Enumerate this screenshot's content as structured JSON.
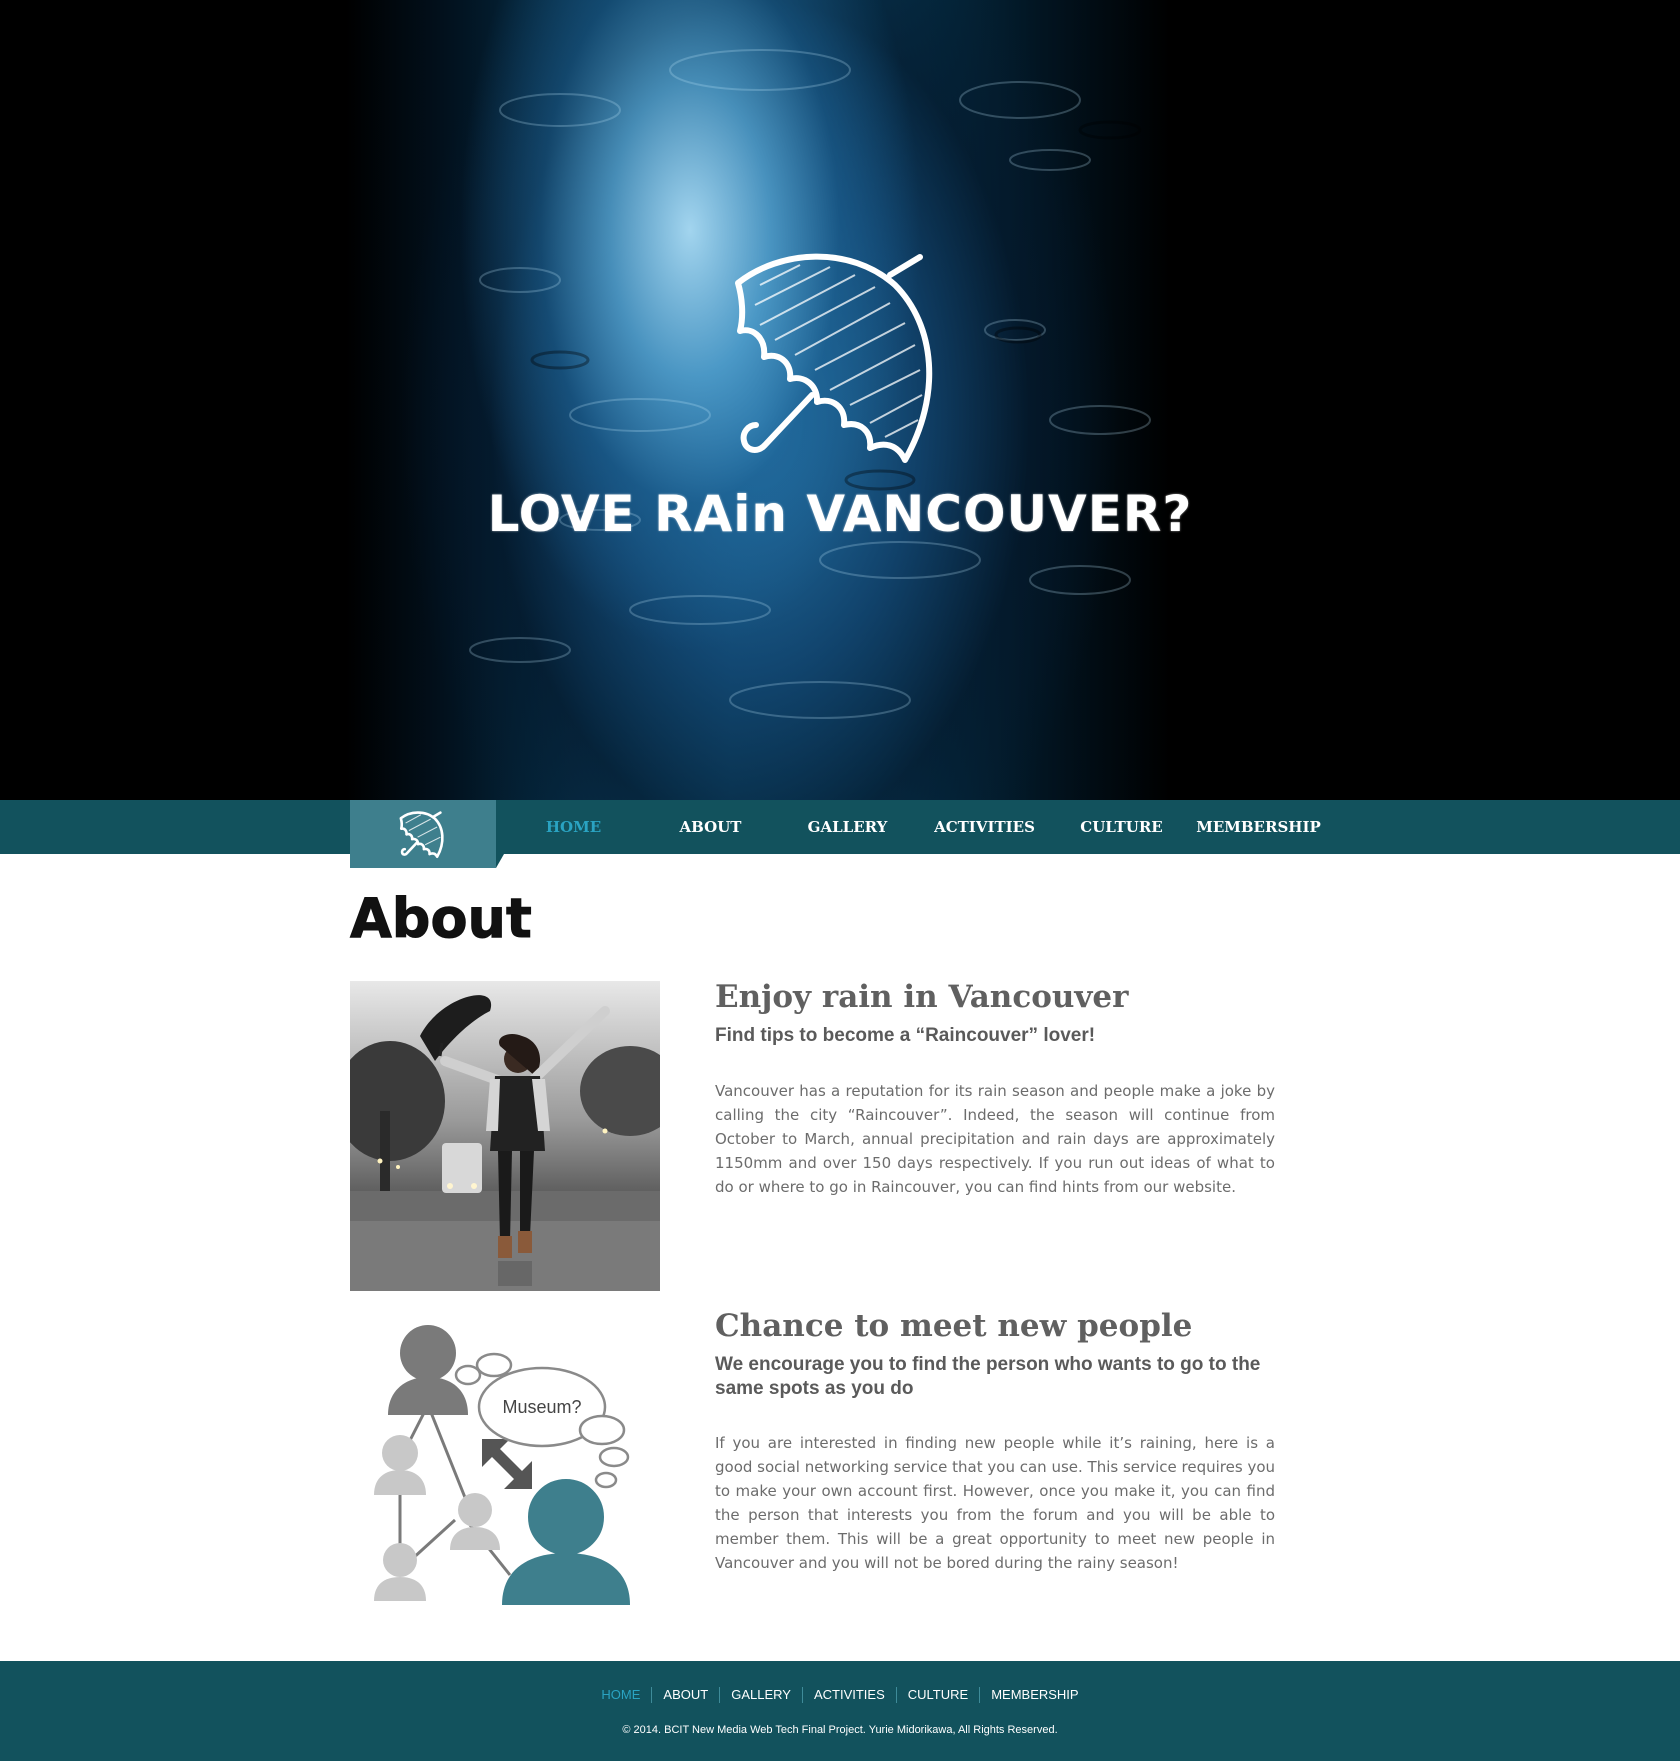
{
  "hero": {
    "logo_icon": "umbrella-icon",
    "title": "LOVE RAin VANCOUVER?"
  },
  "nav": {
    "logo_icon": "umbrella-icon",
    "items": [
      {
        "label": "HOME",
        "active": true
      },
      {
        "label": "ABOUT",
        "active": false
      },
      {
        "label": "GALLERY",
        "active": false
      },
      {
        "label": "ACTIVITIES",
        "active": false
      },
      {
        "label": "CULTURE",
        "active": false
      },
      {
        "label": "MEMBERSHIP",
        "active": false
      }
    ]
  },
  "page": {
    "title": "About"
  },
  "sections": [
    {
      "title": "Enjoy rain in Vancouver",
      "subtitle": "Find tips to become a “Raincouver” lover!",
      "body": "Vancouver has a reputation for its rain season and people make a joke by calling the city “Raincouver”. Indeed, the season will continue from October to March, annual precipitation and rain days are approximately 1150mm and over 150 days respectively. If you run out ideas of what to do or where to go in Raincouver, you can find hints from our website."
    },
    {
      "title": "Chance to meet new people",
      "subtitle": "We encourage you to find the person who wants to go to the same spots as you do",
      "body": "If you are interested in finding new people while it’s raining, here is a good social networking service that you can use. This service requires you to make your own account first. However, once you make it, you can find the person that interests you from the forum and you will be able to member them. This will be a great opportunity to meet new people in Vancouver and you will not be bored during the rainy season!",
      "illustration_bubble": "Museum?"
    }
  ],
  "footer": {
    "links": [
      "HOME",
      "ABOUT",
      "GALLERY",
      "ACTIVITIES",
      "CULTURE",
      "MEMBERSHIP"
    ],
    "copyright": "© 2014. BCIT New Media Web Tech Final Project. Yurie Midorikawa, All Rights Reserved."
  },
  "colors": {
    "nav_bg": "#12525d",
    "nav_logo_bg": "#3e7f8d",
    "accent": "#2aa3c2",
    "heading_gray": "#606060"
  }
}
